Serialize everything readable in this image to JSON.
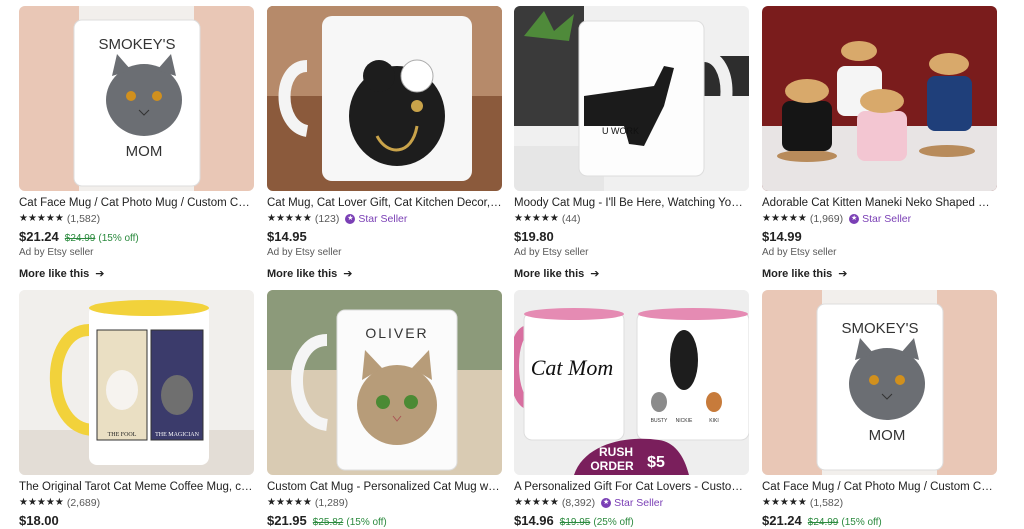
{
  "products": [
    {
      "title": "Cat Face Mug / Cat Photo Mug / Custom Cat Mug / Cat Mom Mug",
      "stars": "★★★★★",
      "reviews": "(1,582)",
      "star_seller": "",
      "price": "$21.24",
      "original_price": "$24.99",
      "discount": "(15% off)",
      "ad": "Ad by Etsy seller",
      "more": "More like this",
      "mug_text_top": "SMOKEY'S",
      "mug_text_bottom": "MOM"
    },
    {
      "title": "Cat Mug, Cat Lover Gift, Cat Kitchen Decor, Yin Yang Cat",
      "stars": "★★★★★",
      "reviews": "(123)",
      "star_seller": "Star Seller",
      "price": "$14.95",
      "original_price": "",
      "discount": "",
      "ad": "Ad by Etsy seller",
      "more": "More like this"
    },
    {
      "title": "Moody Cat Mug - I'll Be Here, Watching You Work",
      "stars": "★★★★★",
      "reviews": "(44)",
      "star_seller": "",
      "price": "$19.80",
      "original_price": "",
      "discount": "",
      "ad": "Ad by Etsy seller",
      "more": "More like this",
      "mug_text": "U WORK"
    },
    {
      "title": "Adorable Cat Kitten Maneki Neko Shaped Ceramic Mug",
      "stars": "★★★★★",
      "reviews": "(1,969)",
      "star_seller": "Star Seller",
      "price": "$14.99",
      "original_price": "",
      "discount": "",
      "ad": "Ad by Etsy seller",
      "more": "More like this"
    },
    {
      "title": "The Original Tarot Cat Meme Coffee Mug, cat lover gift",
      "stars": "★★★★★",
      "reviews": "(2,689)",
      "star_seller": "",
      "price": "$18.00",
      "original_price": "",
      "discount": "",
      "ad": "",
      "more": "",
      "mug_text_left": "THE FOOL",
      "mug_text_right": "THE MAGICIAN"
    },
    {
      "title": "Custom Cat Mug - Personalized Cat Mug with Name",
      "stars": "★★★★★",
      "reviews": "(1,289)",
      "star_seller": "",
      "price": "$21.95",
      "original_price": "$25.82",
      "discount": "(15% off)",
      "ad": "",
      "more": "",
      "mug_text": "OLIVER"
    },
    {
      "title": "A Personalized Gift For Cat Lovers - Custom \"Cat Mom\" Mug",
      "stars": "★★★★★",
      "reviews": "(8,392)",
      "star_seller": "Star Seller",
      "price": "$14.96",
      "original_price": "$19.95",
      "discount": "(25% off)",
      "ad": "",
      "more": "",
      "mug_text": "Cat Mom",
      "names": [
        "BUSTY",
        "NICKIE",
        "KIKI"
      ],
      "rush_line1": "RUSH",
      "rush_line2": "ORDER",
      "rush_price": "$5"
    },
    {
      "title": "Cat Face Mug / Cat Photo Mug / Custom Cat Mug / Cat Mom Mug",
      "stars": "★★★★★",
      "reviews": "(1,582)",
      "star_seller": "",
      "price": "$21.24",
      "original_price": "$24.99",
      "discount": "(15% off)",
      "ad": "",
      "more": "",
      "mug_text_top": "SMOKEY'S",
      "mug_text_bottom": "MOM"
    }
  ]
}
